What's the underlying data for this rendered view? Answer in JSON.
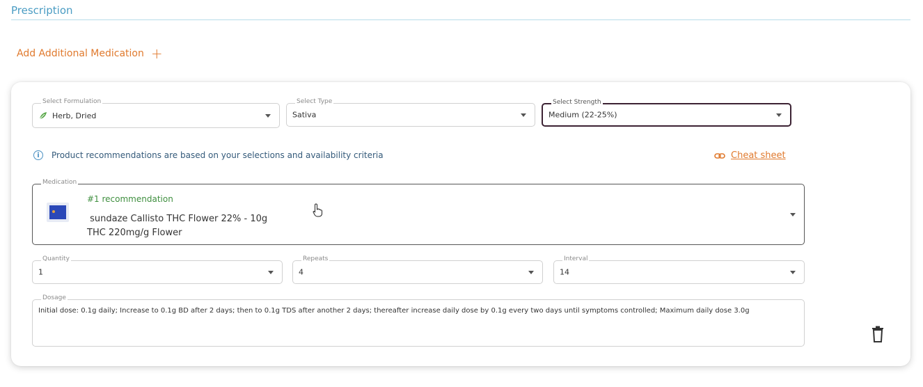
{
  "section": {
    "title": "Prescription"
  },
  "add_medication": {
    "label": "Add Additional Medication",
    "plus": "+"
  },
  "formulation": {
    "label": "Select Formulation",
    "value": "Herb, Dried",
    "icon": "leaf-icon"
  },
  "type": {
    "label": "Select Type",
    "value": "Sativa"
  },
  "strength": {
    "label": "Select Strength",
    "value": "Medium (22-25%)"
  },
  "info": {
    "text": "Product recommendations are based on your selections and availability criteria",
    "icon": "info-icon"
  },
  "cheat_sheet": {
    "label": "Cheat sheet",
    "icon": "link-icon"
  },
  "medication": {
    "label": "Medication",
    "rank": "#1 recommendation",
    "name": " sundaze Callisto THC Flower 22% - 10g\nTHC 220mg/g Flower"
  },
  "quantity": {
    "label": "Quantity",
    "value": "1"
  },
  "repeats": {
    "label": "Repeats",
    "value": "4"
  },
  "interval": {
    "label": "Interval",
    "value": "14"
  },
  "dosage": {
    "label": "Dosage",
    "value": "Initial dose: 0.1g daily; Increase to 0.1g BD after 2 days; then to 0.1g TDS after another 2 days; thereafter increase daily dose by 0.1g every two days until symptoms controlled; Maximum daily dose 3.0g"
  },
  "colors": {
    "accent": "#e07a2e",
    "title": "#4a9cc3",
    "active_border": "#3c2233",
    "recommendation": "#3f8f3f"
  }
}
